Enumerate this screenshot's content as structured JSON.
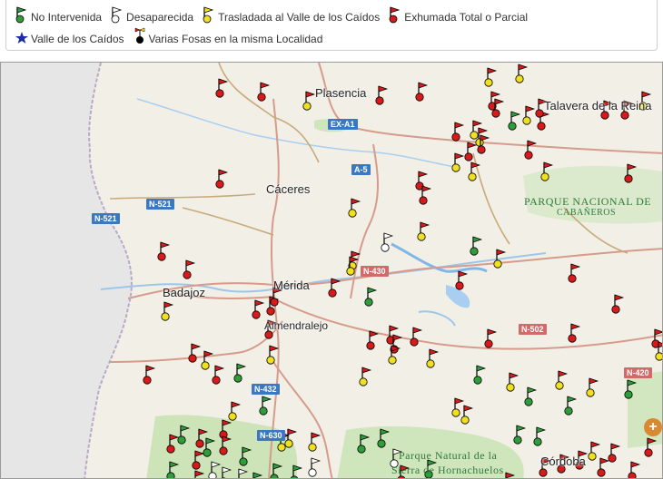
{
  "legend": {
    "items": [
      {
        "label": "No Intervenida",
        "icon": "green-flag-icon",
        "color": "#2e9e3a"
      },
      {
        "label": "Desaparecida",
        "icon": "white-flag-icon",
        "color": "#ffffff"
      },
      {
        "label": "Trasladada al Valle de los Caídos",
        "icon": "yellow-flag-icon",
        "color": "#f0e020"
      },
      {
        "label": "Exhumada Total o Parcial",
        "icon": "red-flag-icon",
        "color": "#d81a1a"
      },
      {
        "label": "Valle de los Caídos",
        "icon": "blue-star-icon",
        "color": "#1a2aa8"
      },
      {
        "label": "Varias Fosas en la misma Localidad",
        "icon": "multi-marker-icon",
        "color": "#000000"
      }
    ]
  },
  "map": {
    "cities": [
      "Plasencia",
      "Talavera de la Reina",
      "Cáceres",
      "Badajoz",
      "Mérida",
      "Almendralejo",
      "Córdoba"
    ],
    "parks": [
      "PARQUE NACIONAL DE",
      "CABAÑEROS",
      "Parque Natural de la",
      "Sierra de Hornachuelos"
    ],
    "roads": [
      "EX-A1",
      "A-5",
      "N-521",
      "N-521",
      "N-430",
      "N-502",
      "N-432",
      "N-630",
      "N-420"
    ]
  }
}
